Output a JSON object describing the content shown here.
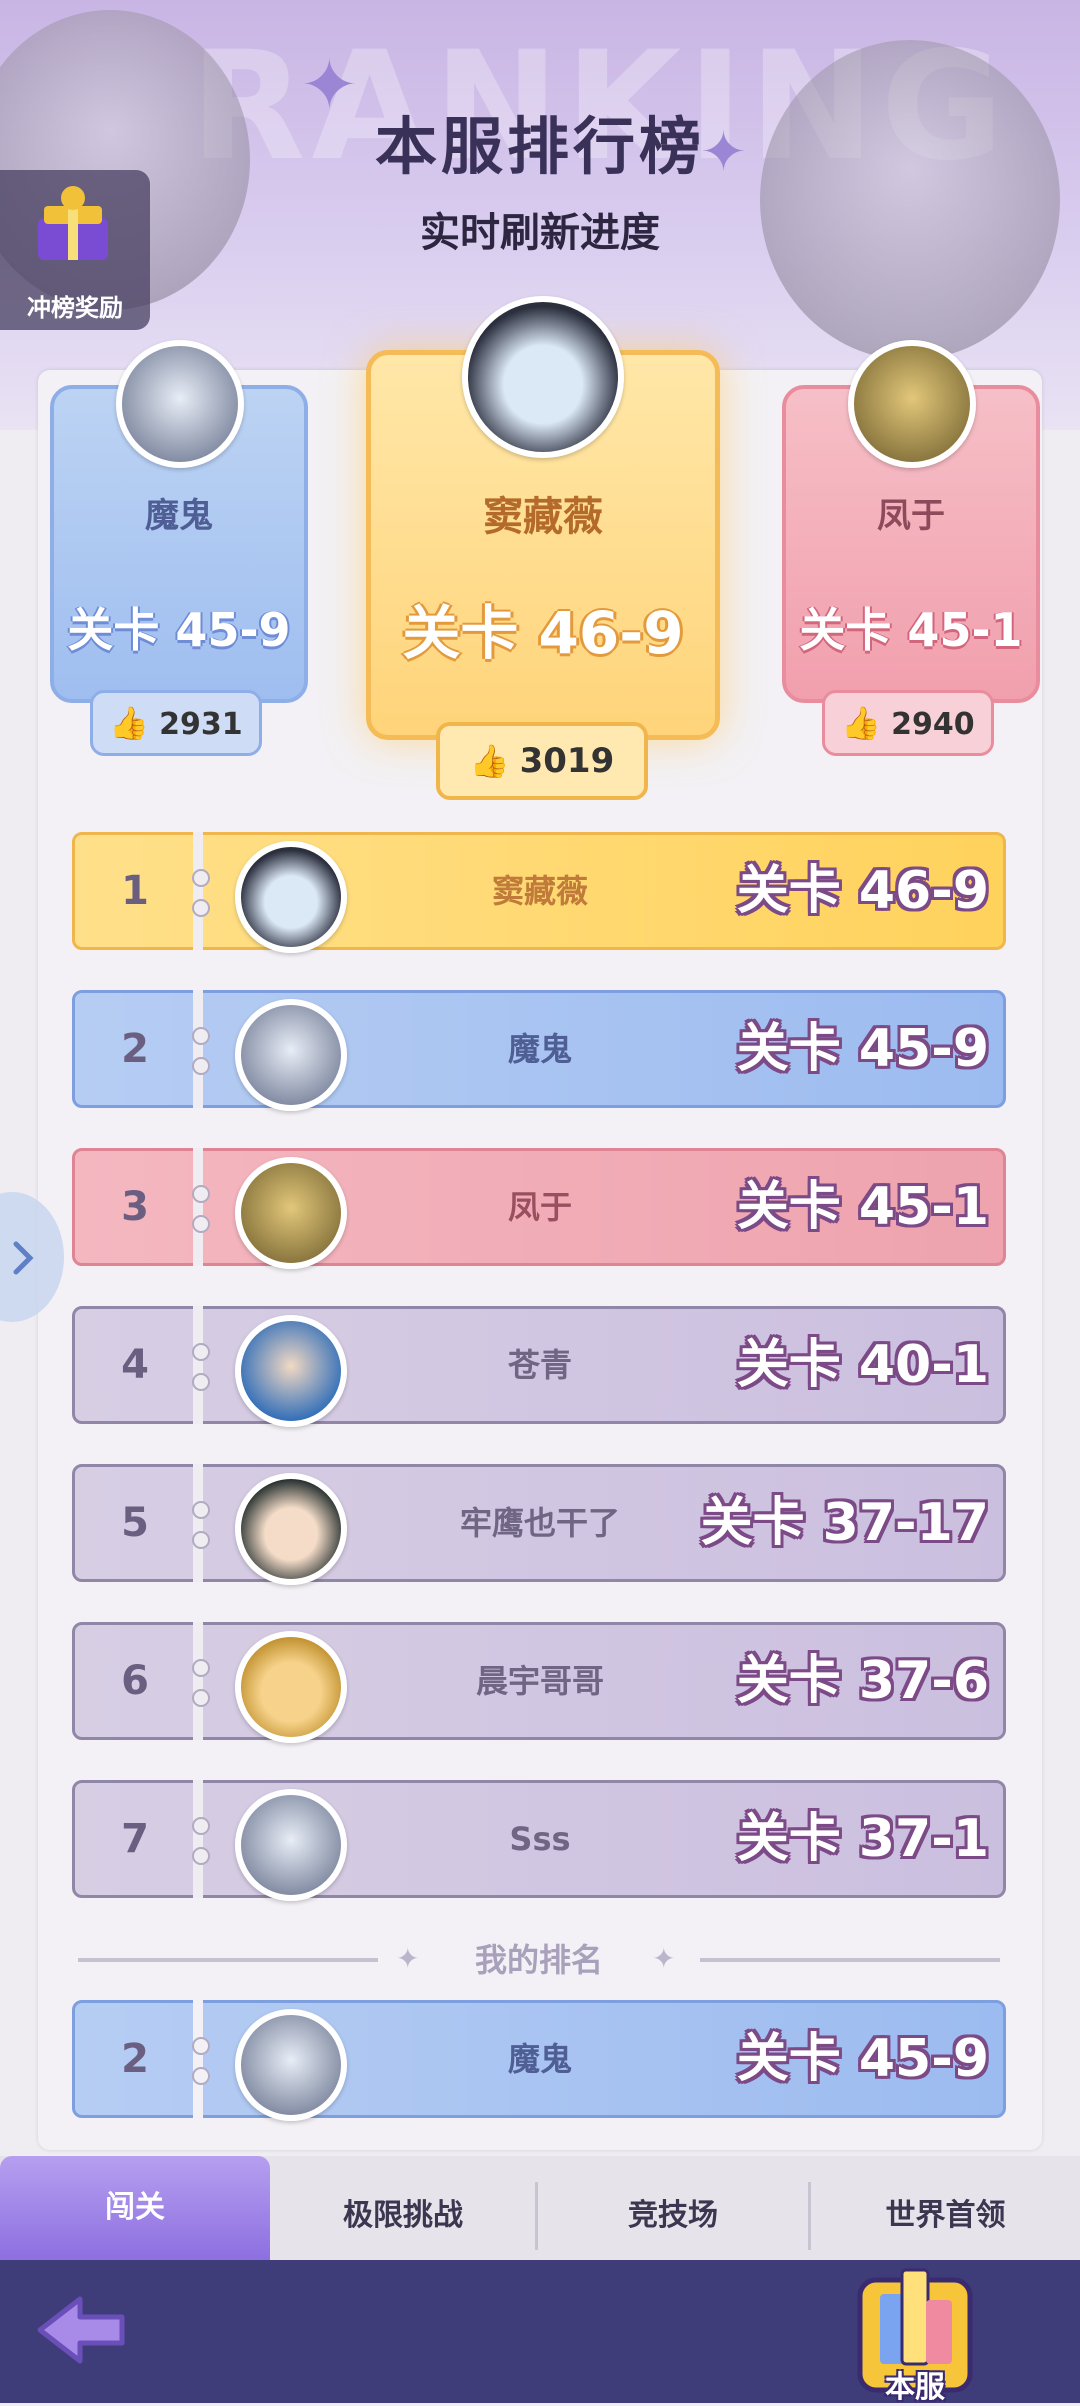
{
  "header": {
    "bg_word": "RANKING",
    "title": "本服排行榜",
    "subtitle": "实时刷新进度"
  },
  "reward_button": {
    "label": "冲榜奖励",
    "icon": "trophy-gift-icon"
  },
  "podium": [
    {
      "name": "魔鬼",
      "stage": "关卡 45-9",
      "likes": "2931",
      "color": "#9fbef0",
      "avatar": "hooded-ghost-avatar"
    },
    {
      "name": "窦藏薇",
      "stage": "关卡 46-9",
      "likes": "3019",
      "color": "#ffd47a",
      "avatar": "black-hat-girl-avatar"
    },
    {
      "name": "凤于",
      "stage": "关卡 45-1",
      "likes": "2940",
      "color": "#f19fad",
      "avatar": "gold-robot-avatar"
    }
  ],
  "leaderboard": [
    {
      "rank": "1",
      "name": "窦藏薇",
      "stage": "关卡 46-9",
      "style": "gold"
    },
    {
      "rank": "2",
      "name": "魔鬼",
      "stage": "关卡 45-9",
      "style": "blue"
    },
    {
      "rank": "3",
      "name": "凤于",
      "stage": "关卡 45-1",
      "style": "pink"
    },
    {
      "rank": "4",
      "name": "苍青",
      "stage": "关卡 40-1",
      "style": "purple"
    },
    {
      "rank": "5",
      "name": "牢鹰也干了",
      "stage": "关卡 37-17",
      "style": "purple"
    },
    {
      "rank": "6",
      "name": "晨宇哥哥",
      "stage": "关卡 37-6",
      "style": "purple"
    },
    {
      "rank": "7",
      "name": "Sss",
      "stage": "关卡 37-1",
      "style": "purple"
    }
  ],
  "my_rank": {
    "label": "我的排名",
    "rank": "2",
    "name": "魔鬼",
    "stage": "关卡 45-9"
  },
  "tabs": [
    {
      "label": "闯关",
      "active": true
    },
    {
      "label": "极限挑战",
      "active": false
    },
    {
      "label": "竞技场",
      "active": false
    },
    {
      "label": "世界首领",
      "active": false
    }
  ],
  "bottom_bar": {
    "back_icon": "back-arrow-icon",
    "server_label": "本服"
  }
}
